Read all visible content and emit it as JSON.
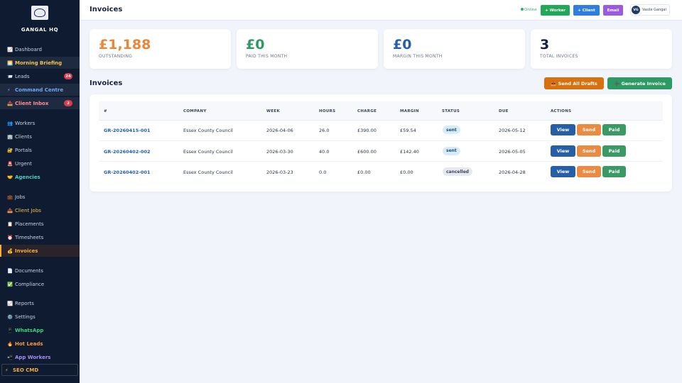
{
  "sidebar": {
    "brand": "GANGAL HQ",
    "logo_text": "GANGAL",
    "items": [
      {
        "label": "Dashboard",
        "icon": "📈"
      },
      {
        "label": "Morning Briefing",
        "icon": "🌅"
      },
      {
        "label": "Leads",
        "icon": "📨",
        "badge": "24"
      },
      {
        "label": "Command Centre",
        "icon": "⚡"
      },
      {
        "label": "Client Inbox",
        "icon": "📥",
        "badge": "2"
      },
      {
        "label": "Workers",
        "icon": "👥"
      },
      {
        "label": "Clients",
        "icon": "🏢"
      },
      {
        "label": "Portals",
        "icon": "🔐"
      },
      {
        "label": "Urgent",
        "icon": "🚨"
      },
      {
        "label": "Agencies",
        "icon": "🤝"
      },
      {
        "label": "Jobs",
        "icon": "💼"
      },
      {
        "label": "Client Jobs",
        "icon": "📥"
      },
      {
        "label": "Placements",
        "icon": "📋"
      },
      {
        "label": "Timesheets",
        "icon": "⏰"
      },
      {
        "label": "Invoices",
        "icon": "💰"
      },
      {
        "label": "Documents",
        "icon": "📄"
      },
      {
        "label": "Compliance",
        "icon": "✅"
      },
      {
        "label": "Reports",
        "icon": "📈"
      },
      {
        "label": "Settings",
        "icon": "⚙️"
      },
      {
        "label": "WhatsApp",
        "icon": "📱"
      },
      {
        "label": "Hot Leads",
        "icon": "🔥"
      },
      {
        "label": "App Workers",
        "icon": "📲"
      },
      {
        "label": "SEO CMD",
        "icon": "⚡"
      }
    ]
  },
  "header": {
    "title": "Invoices",
    "status": "Online",
    "buttons": {
      "worker": "+ Worker",
      "client": "+ Client",
      "email": "Email"
    },
    "user_initials": "VG",
    "user_name": "Vasile Gangal"
  },
  "stats": [
    {
      "value": "£1,188",
      "label": "OUTSTANDING",
      "color": "#e8873a"
    },
    {
      "value": "£0",
      "label": "PAID THIS MONTH",
      "color": "#2e9a63"
    },
    {
      "value": "£0",
      "label": "MARGIN THIS MONTH",
      "color": "#275ea8"
    },
    {
      "value": "3",
      "label": "TOTAL INVOICES",
      "color": "#15233d"
    }
  ],
  "section": {
    "title": "Invoices",
    "send_drafts": "📤 Send All Drafts",
    "generate": "➕ Generate Invoice"
  },
  "table": {
    "headers": [
      "#",
      "COMPANY",
      "WEEK",
      "HOURS",
      "CHARGE",
      "MARGIN",
      "STATUS",
      "DUE",
      "ACTIONS"
    ],
    "rows": [
      {
        "id": "GR-20260415-001",
        "company": "Essex County Council",
        "week": "2026-04-06",
        "hours": "26.0",
        "charge": "£390.00",
        "margin": "£59.54",
        "status": "sent",
        "due": "2026-05-12"
      },
      {
        "id": "GR-20260402-002",
        "company": "Essex County Council",
        "week": "2026-03-30",
        "hours": "40.0",
        "charge": "£600.00",
        "margin": "£142.40",
        "status": "sent",
        "due": "2026-05-05"
      },
      {
        "id": "GR-20260402-001",
        "company": "Essex County Council",
        "week": "2026-03-23",
        "hours": "0.0",
        "charge": "£0.00",
        "margin": "£0.00",
        "status": "cancelled",
        "due": "2026-04-28"
      }
    ],
    "actions": {
      "view": "View",
      "send": "Send",
      "paid": "Paid"
    }
  },
  "colors": {
    "sidebar_bg": "#0f1b30",
    "accent_orange": "#e8873a",
    "view_blue": "#275ea8",
    "send_orange": "#ea8a43",
    "paid_green": "#3a9a63"
  }
}
